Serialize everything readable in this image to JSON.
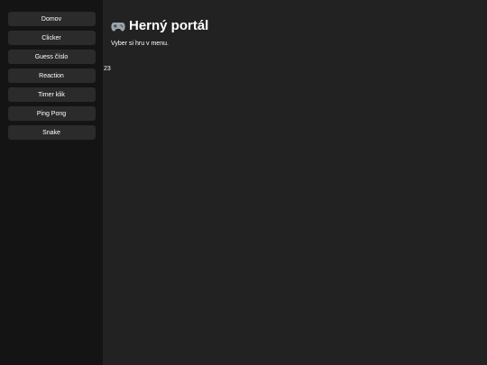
{
  "sidebar": {
    "items": [
      {
        "label": "Domov"
      },
      {
        "label": "Clicker"
      },
      {
        "label": "Guess číslo"
      },
      {
        "label": "Reaction"
      },
      {
        "label": "Timer klik"
      },
      {
        "label": "Ping Pong"
      },
      {
        "label": "Snake"
      }
    ]
  },
  "main": {
    "title": "Herný portál",
    "title_icon": "game-controller-icon",
    "subtitle": "Vyber si hru v menu.",
    "counter": "23"
  },
  "colors": {
    "sidebar_bg": "#141414",
    "main_bg": "#222222",
    "button_bg": "#2b2b2b",
    "text": "#ffffff"
  }
}
